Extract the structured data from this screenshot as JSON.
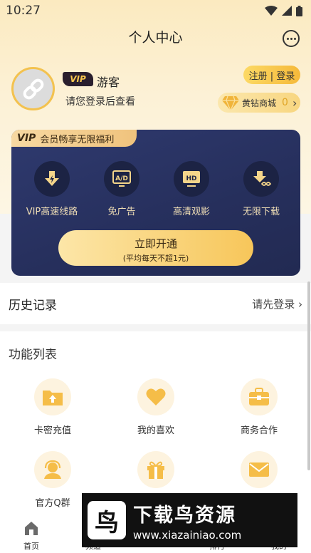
{
  "status_bar": {
    "time": "10:27"
  },
  "header": {
    "title": "个人中心"
  },
  "profile": {
    "vip_badge": "VIP",
    "name": "游客",
    "hint": "请您登录后查看",
    "login_button": "注册 | 登录",
    "mall_label": "黄钻商城",
    "mall_count": "0"
  },
  "vip_card": {
    "banner_vip": "VIP",
    "banner_text": "会员畅享无限福利",
    "perks": [
      {
        "icon": "download-arrow-icon",
        "label": "VIP高速线路"
      },
      {
        "icon": "ad-free-icon",
        "label": "免广告"
      },
      {
        "icon": "hd-icon",
        "label": "高清观影"
      },
      {
        "icon": "unlimited-download-icon",
        "label": "无限下载"
      }
    ],
    "open_button": "立即开通",
    "open_sub": "(平均每天不超1元)"
  },
  "history": {
    "title": "历史记录",
    "link": "请先登录"
  },
  "features": {
    "title": "功能列表",
    "items": [
      {
        "icon": "upload-folder-icon",
        "label": "卡密充值"
      },
      {
        "icon": "heart-icon",
        "label": "我的喜欢"
      },
      {
        "icon": "briefcase-icon",
        "label": "商务合作"
      },
      {
        "icon": "support-agent-icon",
        "label": "官方Q群"
      },
      {
        "icon": "gift-icon",
        "label": ""
      },
      {
        "icon": "mail-icon",
        "label": ""
      }
    ]
  },
  "bottom_nav": {
    "items": [
      {
        "icon": "home-icon",
        "label": "首页"
      },
      {
        "icon": "channel-icon",
        "label": "频道"
      },
      {
        "icon": "vip-icon",
        "label": "VIP"
      },
      {
        "icon": "rank-icon",
        "label": "排行"
      },
      {
        "icon": "profile-icon",
        "label": "我的"
      }
    ]
  },
  "watermark": {
    "logo": "鸟",
    "title": "下载鸟资源",
    "url": "www.xiazainiao.com"
  },
  "colors": {
    "accent": "#f5b93a",
    "vip_card": "#262f5c",
    "gold_text": "#f1dfb6"
  }
}
